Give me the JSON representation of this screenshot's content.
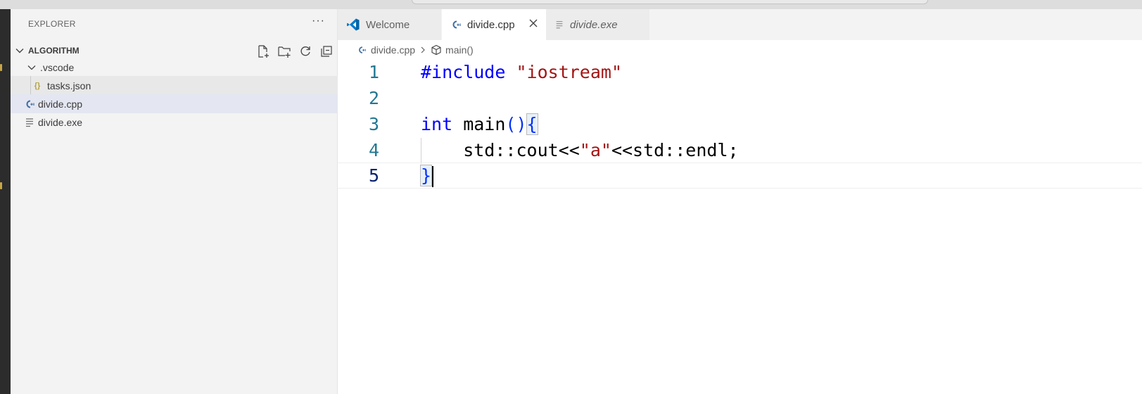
{
  "explorer": {
    "header": "EXPLORER",
    "more_label": "···",
    "folder": "ALGORITHM",
    "tree": [
      {
        "label": ".vscode",
        "icon": "chevron-down-icon"
      },
      {
        "label": "tasks.json",
        "icon": "json-braces-icon"
      },
      {
        "label": "divide.cpp",
        "icon": "cpp-file-icon"
      },
      {
        "label": "divide.exe",
        "icon": "binary-file-icon"
      }
    ]
  },
  "tabs": [
    {
      "label": "Welcome",
      "icon": "vscode-logo-icon"
    },
    {
      "label": "divide.cpp",
      "icon": "cpp-file-icon"
    },
    {
      "label": "divide.exe",
      "icon": "binary-file-icon"
    }
  ],
  "breadcrumb": {
    "file": "divide.cpp",
    "symbol": "main()"
  },
  "editor": {
    "line_numbers": [
      "1",
      "2",
      "3",
      "4",
      "5"
    ],
    "lines": {
      "l1_kw": "#include",
      "l1_str": "\"iostream\"",
      "l3_kw": "int",
      "l3_fn": " main",
      "l3_paren": "()",
      "l3_brace": "{",
      "l4_pre": "    std::cout<<",
      "l4_str": "\"a\"",
      "l4_post": "<<std::endl;",
      "l5_brace": "}"
    }
  },
  "colors": {
    "keyword": "#0000ff",
    "string": "#a31515",
    "line_number": "#237893",
    "sidebar_bg": "#f3f3f3",
    "activity_bar": "#2c2c2c"
  }
}
